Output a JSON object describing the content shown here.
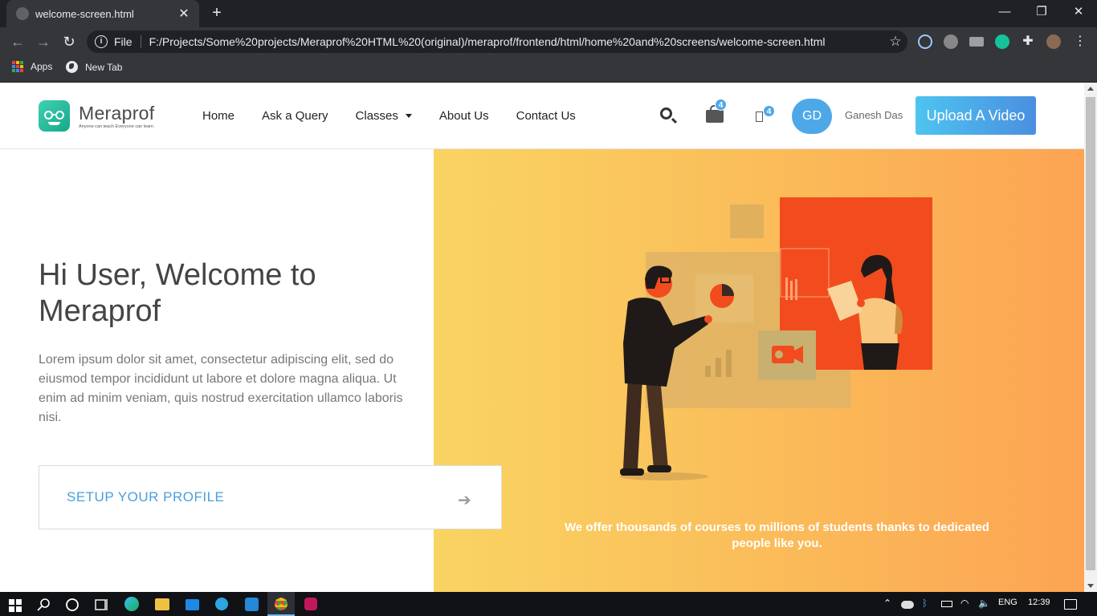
{
  "browser": {
    "tab_title": "welcome-screen.html",
    "new_tab_symbol": "+",
    "scheme": "File",
    "url": "F:/Projects/Some%20projects/Meraprof%20HTML%20(original)/meraprof/frontend/html/home%20and%20screens/welcome-screen.html",
    "bookmarks": [
      "Apps",
      "New Tab"
    ]
  },
  "site": {
    "brand": "Meraprof",
    "tagline": "Anyone can teach Everyone can learn",
    "nav": [
      "Home",
      "Ask a Query",
      "Classes",
      "About Us",
      "Contact Us"
    ],
    "cart_badge": "4",
    "notif_badge": "4",
    "avatar_initials": "GD",
    "user_name": "Ganesh Das",
    "upload_label": "Upload A Video",
    "accent": "#4ea8e8"
  },
  "hero": {
    "title": "Hi User, Welcome to Meraprof",
    "text": "Lorem ipsum dolor sit amet, consectetur adipiscing elit, sed do eiusmod tempor incididunt ut labore et dolore magna aliqua. Ut enim ad minim veniam, quis nostrud exercitation ullamco laboris nisi.",
    "setup_label": "SETUP YOUR PROFILE",
    "offer": "We offer thousands of courses to millions of students thanks to dedicated people like you."
  },
  "taskbar": {
    "language": "ENG",
    "time": "12:39"
  },
  "icons": [
    "search-icon",
    "shopping-bag-icon",
    "notification-icon",
    "arrow-right-icon",
    "windows-start-icon",
    "chrome-icon"
  ]
}
